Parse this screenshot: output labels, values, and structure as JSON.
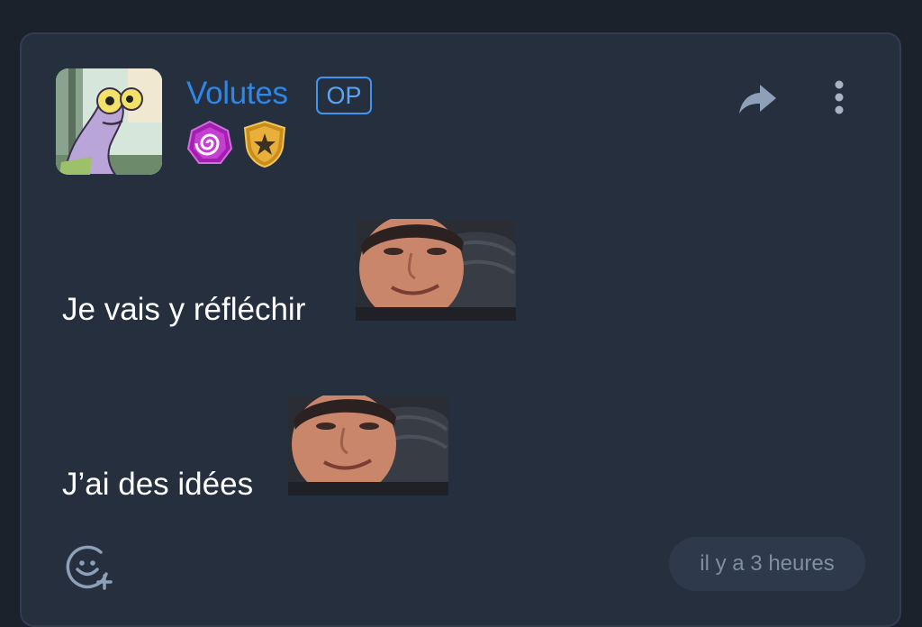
{
  "post": {
    "author": {
      "username": "Volutes",
      "op_badge": "OP",
      "avatar": "cartoon-worm-avatar",
      "badges": [
        "spiral-gem-badge",
        "star-shield-badge"
      ]
    },
    "actions": {
      "share_icon": "share-arrow-icon",
      "more_icon": "vertical-dots-icon",
      "reaction_icon": "add-emoji-icon"
    },
    "lines": [
      {
        "text": "Je vais y réfléchir",
        "sticker": "smiling-man-sticker"
      },
      {
        "text": "J’ai des idées",
        "sticker": "smiling-man-sticker"
      }
    ],
    "timestamp": "il y a 3 heures"
  },
  "colors": {
    "background": "#1c222c",
    "card": "#252f3e",
    "username": "#2f86e6",
    "op_border": "#3f95f0",
    "timestamp_bg": "#2e3a4b",
    "timestamp_text": "#7f8ea3"
  }
}
